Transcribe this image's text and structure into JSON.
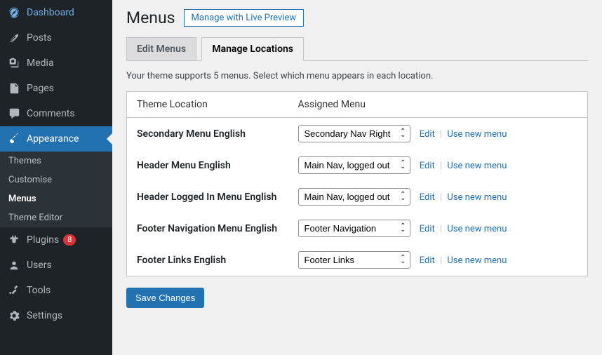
{
  "sidebar": {
    "items": [
      {
        "label": "Dashboard",
        "icon": "dashboard"
      },
      {
        "label": "Posts",
        "icon": "pin"
      },
      {
        "label": "Media",
        "icon": "media"
      },
      {
        "label": "Pages",
        "icon": "pages"
      },
      {
        "label": "Comments",
        "icon": "comment"
      },
      {
        "label": "Appearance",
        "icon": "brush",
        "current": true,
        "submenu": [
          {
            "label": "Themes"
          },
          {
            "label": "Customise"
          },
          {
            "label": "Menus",
            "current": true
          },
          {
            "label": "Theme Editor"
          }
        ]
      },
      {
        "label": "Plugins",
        "icon": "plugin",
        "badge": "8"
      },
      {
        "label": "Users",
        "icon": "users"
      },
      {
        "label": "Tools",
        "icon": "tools"
      },
      {
        "label": "Settings",
        "icon": "settings"
      }
    ]
  },
  "page": {
    "title": "Menus",
    "action": "Manage with Live Preview",
    "tabs": [
      {
        "label": "Edit Menus"
      },
      {
        "label": "Manage Locations",
        "active": true
      }
    ],
    "intro": "Your theme supports 5 menus. Select which menu appears in each location.",
    "table_headers": {
      "location": "Theme Location",
      "assigned": "Assigned Menu"
    },
    "rows": [
      {
        "location": "Secondary Menu English",
        "menu": "Secondary Nav Right"
      },
      {
        "location": "Header Menu English",
        "menu": "Main Nav, logged out"
      },
      {
        "location": "Header Logged In Menu English",
        "menu": "Main Nav, logged out"
      },
      {
        "location": "Footer Navigation Menu English",
        "menu": "Footer Navigation"
      },
      {
        "location": "Footer Links English",
        "menu": "Footer Links"
      }
    ],
    "actions": {
      "edit": "Edit",
      "use_new": "Use new menu"
    },
    "submit": "Save Changes"
  }
}
